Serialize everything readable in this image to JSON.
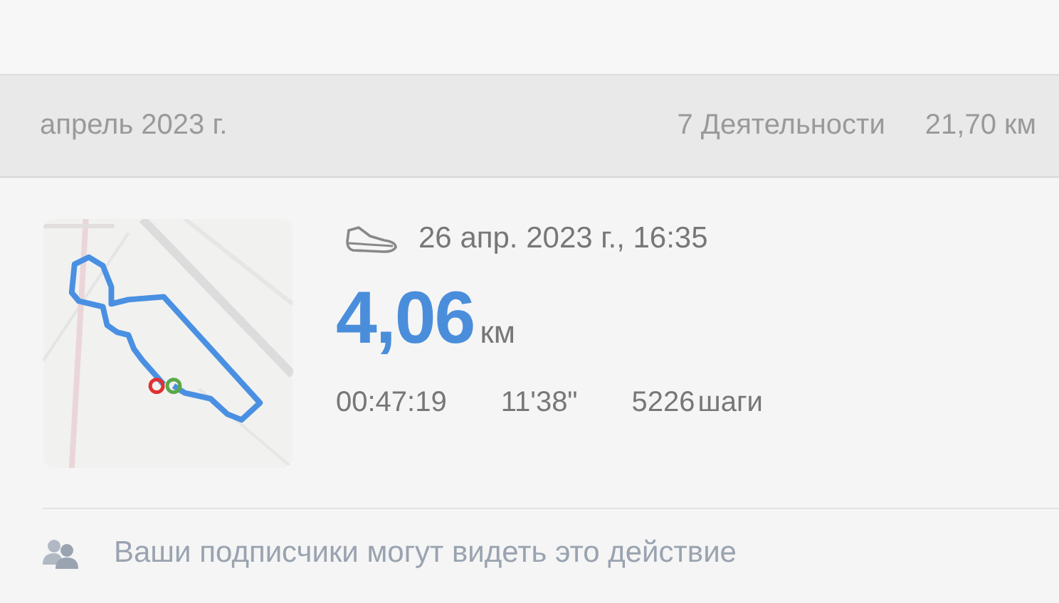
{
  "month_header": {
    "month": "апрель 2023 г.",
    "activities": "7 Деятельности",
    "distance": "21,70 км"
  },
  "activity": {
    "datetime": "26 апр. 2023 г., 16:35",
    "distance_value": "4,06",
    "distance_unit": "км",
    "duration": "00:47:19",
    "pace": "11'38\"",
    "steps_value": "5226",
    "steps_unit": "шаги"
  },
  "visibility_note": "Ваши подписчики могут видеть это действие"
}
